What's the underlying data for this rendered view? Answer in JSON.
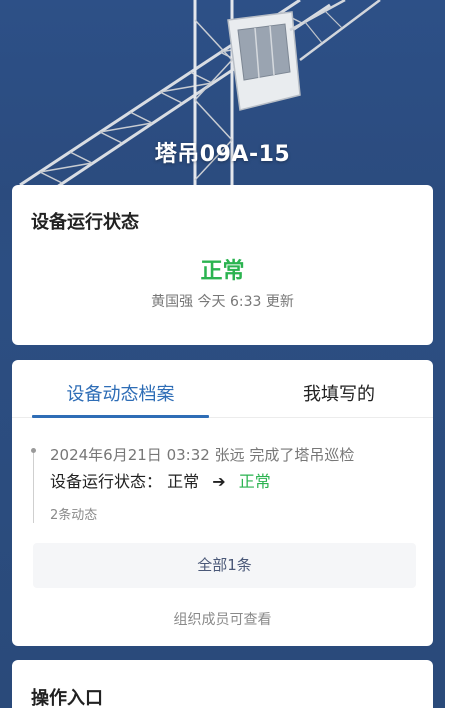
{
  "hero": {
    "title": "塔吊09A-15"
  },
  "status_card": {
    "title": "设备运行状态",
    "status": "正常",
    "updated_by": "黄国强",
    "updated_time": "今天 6:33",
    "updated_suffix": "更新"
  },
  "log_card": {
    "tabs": [
      {
        "label": "设备动态档案",
        "active": true
      },
      {
        "label": "我填写的",
        "active": false
      }
    ],
    "entries": [
      {
        "timestamp": "2024年6月21日 03:32",
        "user": "张远",
        "action": "完成了塔吊巡检",
        "field_label": "设备运行状态：",
        "old_value": "正常",
        "arrow": "➔",
        "new_value": "正常"
      }
    ],
    "count_text": "2条动态",
    "all_button_label": "全部1条",
    "visibility_note": "组织成员可查看"
  },
  "ops_card": {
    "title": "操作入口"
  },
  "colors": {
    "background": "#2c4e82",
    "accent_blue": "#2e6db6",
    "status_green": "#2bb350"
  }
}
